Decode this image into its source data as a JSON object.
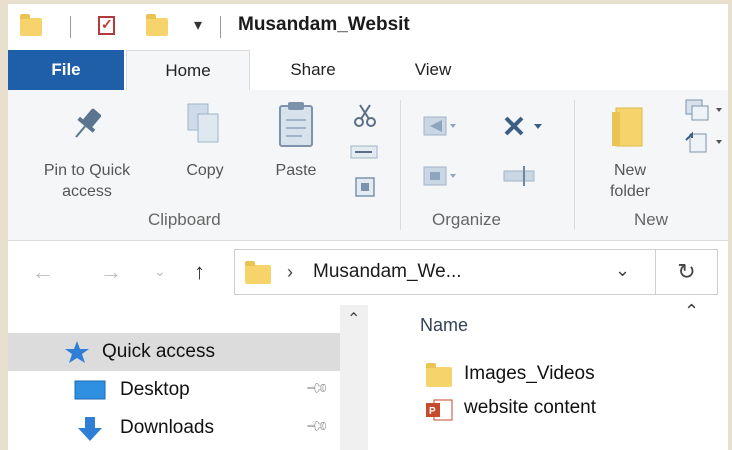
{
  "window": {
    "title": "Musandam_Websit"
  },
  "tabs": {
    "file": "File",
    "home": "Home",
    "share": "Share",
    "view": "View"
  },
  "ribbon": {
    "clipboard": {
      "pin_label_line1": "Pin to Quick",
      "pin_label_line2": "access",
      "copy_label": "Copy",
      "paste_label": "Paste",
      "group_label": "Clipboard"
    },
    "organize": {
      "group_label": "Organize"
    },
    "new": {
      "new_folder_line1": "New",
      "new_folder_line2": "folder",
      "group_label": "New"
    }
  },
  "address_bar": {
    "path": "Musandam_We..."
  },
  "nav_pane": {
    "items": [
      {
        "label": "Quick access",
        "icon": "star-icon"
      },
      {
        "label": "Desktop",
        "icon": "desktop-icon"
      },
      {
        "label": "Downloads",
        "icon": "download-icon"
      }
    ]
  },
  "content": {
    "column_header": "Name",
    "files": [
      {
        "name": "Images_Videos",
        "icon": "folder-icon"
      },
      {
        "name": "website content",
        "icon": "powerpoint-file-icon"
      }
    ]
  },
  "colors": {
    "file_tab": "#1f5faa",
    "folder": "#f6d36b",
    "selected_nav": "#dcdcdc"
  }
}
